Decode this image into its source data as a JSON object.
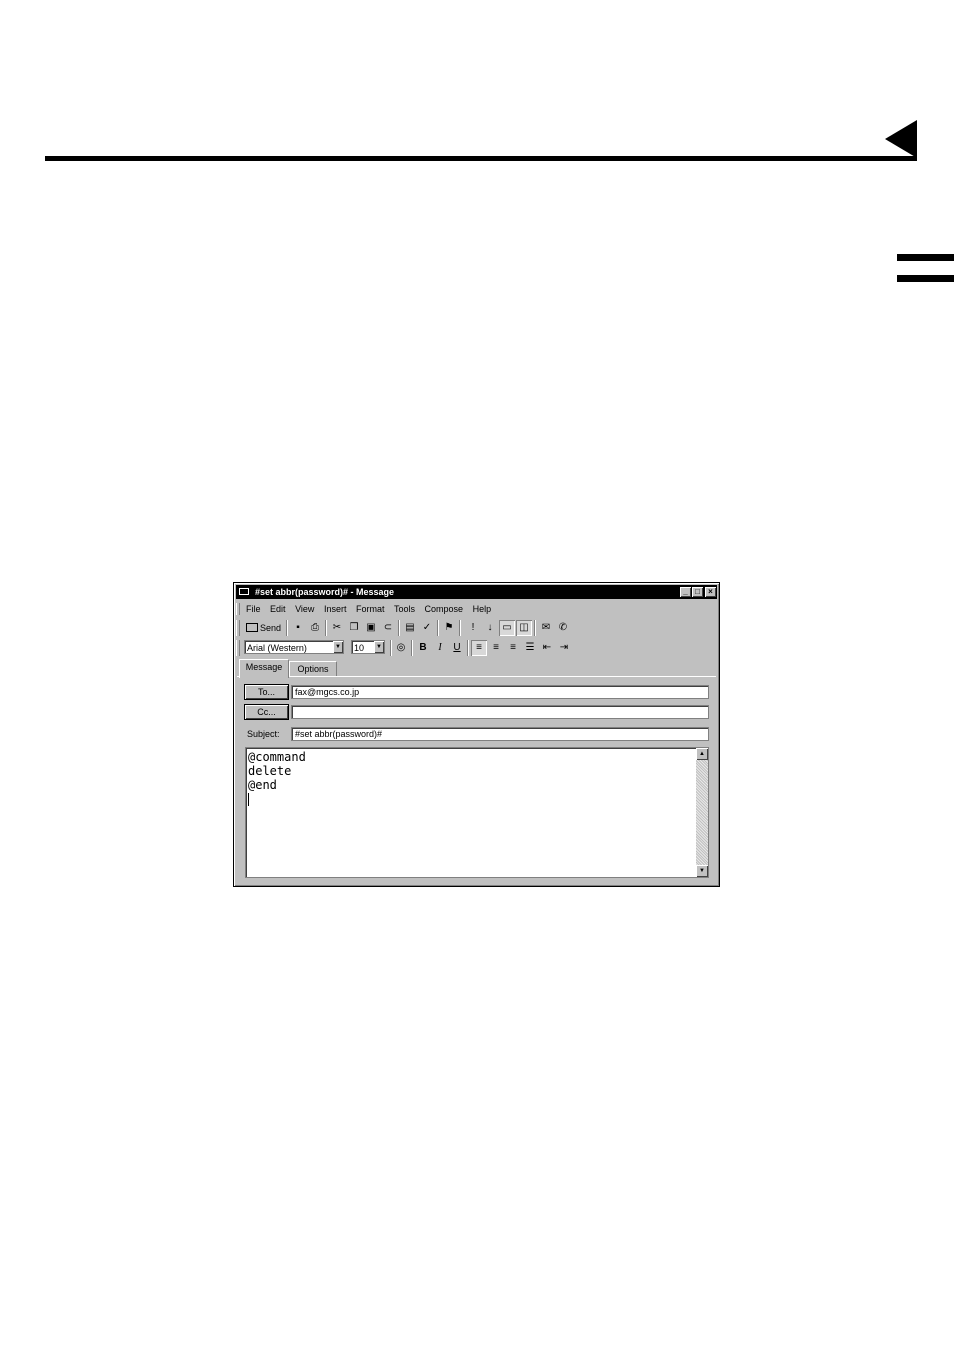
{
  "window": {
    "title": "#set abbr(password)# - Message",
    "minimize_glyph": "_",
    "maximize_glyph": "□",
    "close_glyph": "×"
  },
  "menu": [
    "File",
    "Edit",
    "View",
    "Insert",
    "Format",
    "Tools",
    "Compose",
    "Help"
  ],
  "toolbar": {
    "send_label": "Send",
    "icons": [
      "save-icon",
      "print-icon",
      "cut-icon",
      "copy-icon",
      "paste-icon",
      "attach-icon",
      "address-book-icon",
      "spell-check-icon",
      "priority-flag-icon",
      "high-priority-icon",
      "low-priority-icon",
      "sign-icon",
      "encrypt-icon",
      "offline-icon",
      "read-receipt-icon"
    ]
  },
  "format_bar": {
    "font_value": "Arial (Western)",
    "size_value": "10",
    "bold": "B",
    "italic": "I",
    "underline": "U"
  },
  "tabs": {
    "message": "Message",
    "options": "Options"
  },
  "header": {
    "to_button": "To...",
    "to_value": "fax@mgcs.co.jp",
    "cc_button": "Cc...",
    "cc_value": "",
    "subject_label": "Subject:",
    "subject_value": "#set abbr(password)#"
  },
  "body": {
    "lines": [
      "@command",
      "delete",
      "@end"
    ]
  }
}
